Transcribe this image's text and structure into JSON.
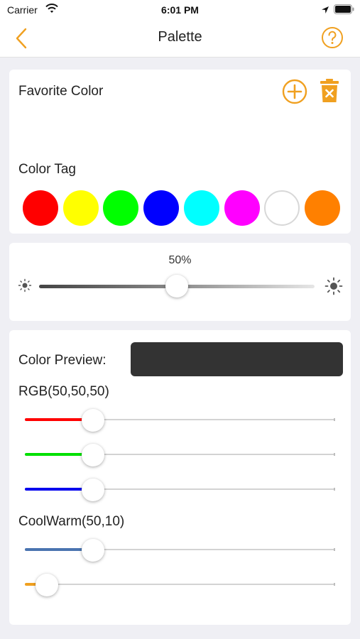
{
  "status_bar": {
    "carrier": "Carrier",
    "time": "6:01 PM"
  },
  "nav": {
    "title": "Palette"
  },
  "favorite": {
    "label": "Favorite Color"
  },
  "color_tag": {
    "label": "Color Tag",
    "swatches": [
      "#ff0000",
      "#ffff00",
      "#00ff00",
      "#0000ff",
      "#00ffff",
      "#ff00ff",
      "#ffffff",
      "#ff8000"
    ]
  },
  "brightness": {
    "label": "50%",
    "value": 0.5
  },
  "preview": {
    "label": "Color Preview:",
    "color": "#333333"
  },
  "rgb": {
    "label": "RGB(50,50,50)",
    "sliders": [
      {
        "color": "#ff0000",
        "value": 0.22
      },
      {
        "color": "#00e000",
        "value": 0.22
      },
      {
        "color": "#0000ee",
        "value": 0.22
      }
    ]
  },
  "coolwarm": {
    "label": "CoolWarm(50,10)",
    "sliders": [
      {
        "color": "#4a74b0",
        "value": 0.22
      },
      {
        "color": "#f0a020",
        "value": 0.07
      }
    ]
  },
  "accent": "#f0a020"
}
